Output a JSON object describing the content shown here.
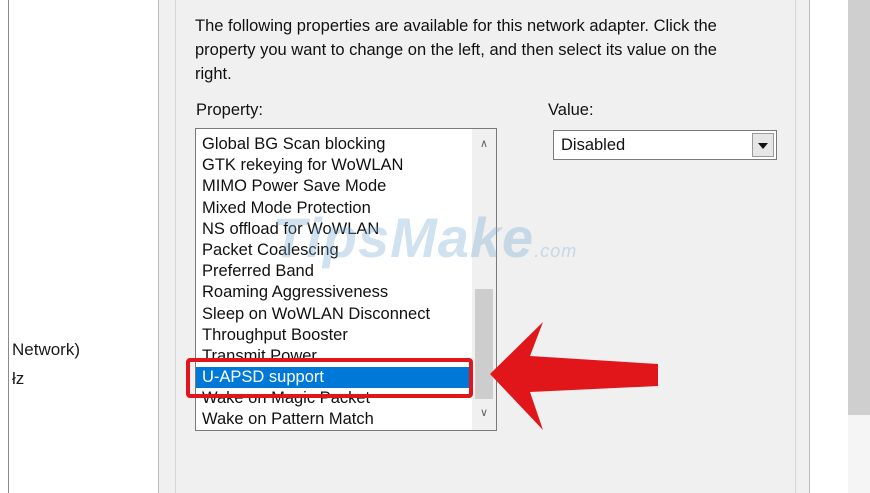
{
  "left_panel": {
    "line1": "Network)",
    "line2": "łz"
  },
  "dialog": {
    "description": "The following properties are available for this network adapter. Click the property you want to change on the left, and then select its value on the right.",
    "property_label": "Property:",
    "value_label": "Value:",
    "properties": [
      "Global BG Scan blocking",
      "GTK rekeying for WoWLAN",
      "MIMO Power Save Mode",
      "Mixed Mode Protection",
      "NS offload for WoWLAN",
      "Packet Coalescing",
      "Preferred Band",
      "Roaming Aggressiveness",
      "Sleep on WoWLAN Disconnect",
      "Throughput Booster",
      "Transmit Power",
      "U-APSD support",
      "Wake on Magic Packet",
      "Wake on Pattern Match"
    ],
    "selected_property": "U-APSD support",
    "value_selected": "Disabled"
  },
  "watermark": {
    "main": "TipsMake",
    "domain": ".com"
  },
  "colors": {
    "selection": "#0078d7",
    "annotation": "#e0161b"
  }
}
